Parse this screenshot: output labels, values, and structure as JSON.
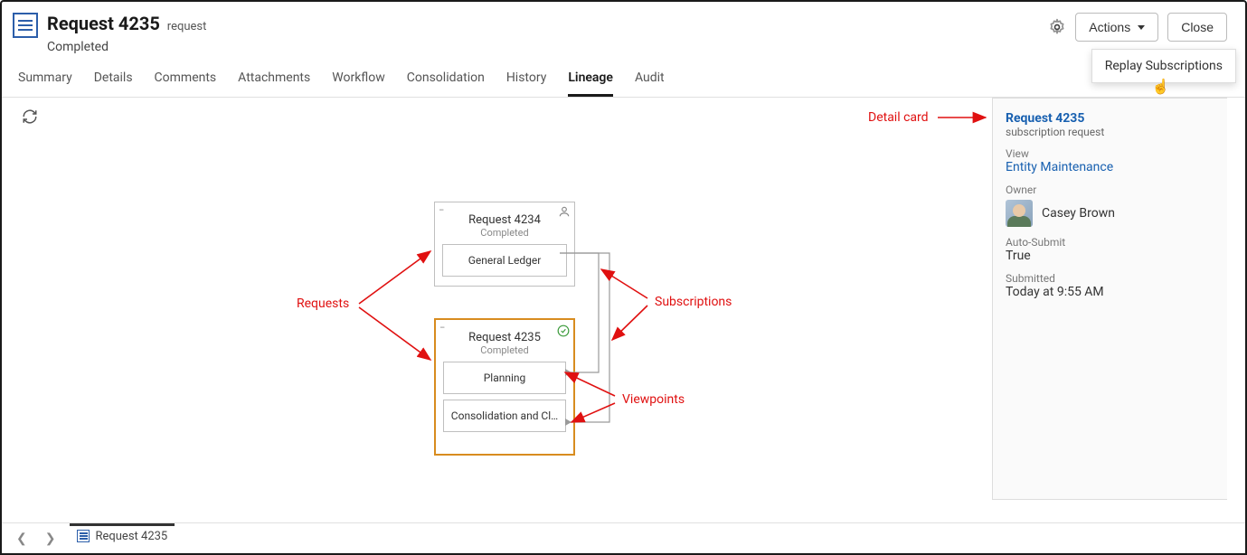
{
  "header": {
    "title": "Request 4235",
    "title_suffix": "request",
    "status": "Completed"
  },
  "actions": {
    "actions_label": "Actions",
    "close_label": "Close",
    "menu": {
      "replay": "Replay Subscriptions"
    }
  },
  "tabs": {
    "summary": "Summary",
    "details": "Details",
    "comments": "Comments",
    "attachments": "Attachments",
    "workflow": "Workflow",
    "consolidation": "Consolidation",
    "history": "History",
    "lineage": "Lineage",
    "audit": "Audit"
  },
  "nodes": {
    "r4234": {
      "title": "Request 4234",
      "status": "Completed",
      "viewpoints": [
        "General Ledger"
      ]
    },
    "r4235": {
      "title": "Request 4235",
      "status": "Completed",
      "viewpoints": [
        "Planning",
        "Consolidation and Cl…"
      ]
    }
  },
  "detail": {
    "title": "Request 4235",
    "subtitle": "subscription request",
    "view_label": "View",
    "view_value": "Entity Maintenance",
    "owner_label": "Owner",
    "owner_value": "Casey Brown",
    "autosubmit_label": "Auto-Submit",
    "autosubmit_value": "True",
    "submitted_label": "Submitted",
    "submitted_value": "Today at 9:55 AM"
  },
  "annotations": {
    "requests": "Requests",
    "subscriptions": "Subscriptions",
    "viewpoints": "Viewpoints",
    "detail_card": "Detail card"
  },
  "footer": {
    "tab_label": "Request 4235"
  }
}
